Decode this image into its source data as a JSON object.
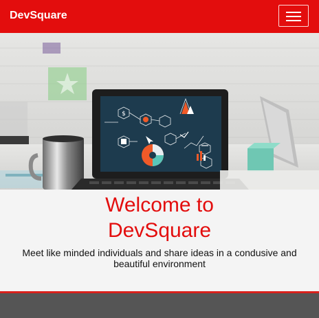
{
  "navbar": {
    "brand": "DevSquare",
    "menu_icon": "hamburger-menu-icon",
    "background_color": "#e30d0d"
  },
  "hero": {
    "icons": [
      "dollar-icon",
      "settings-icon",
      "cursor-icon",
      "lock-icon",
      "pie-chart-icon",
      "line-chart-icon",
      "scale-icon",
      "bar-chart-icon"
    ]
  },
  "intro": {
    "heading_line1": "Welcome to",
    "heading_line2": "DevSquare",
    "tagline": "Meet like minded individuals and share ideas in a condusive and beautiful environment",
    "heading_color": "#e30d0d"
  },
  "footer": {
    "background_color": "#555555",
    "accent_color": "#d8211c"
  }
}
